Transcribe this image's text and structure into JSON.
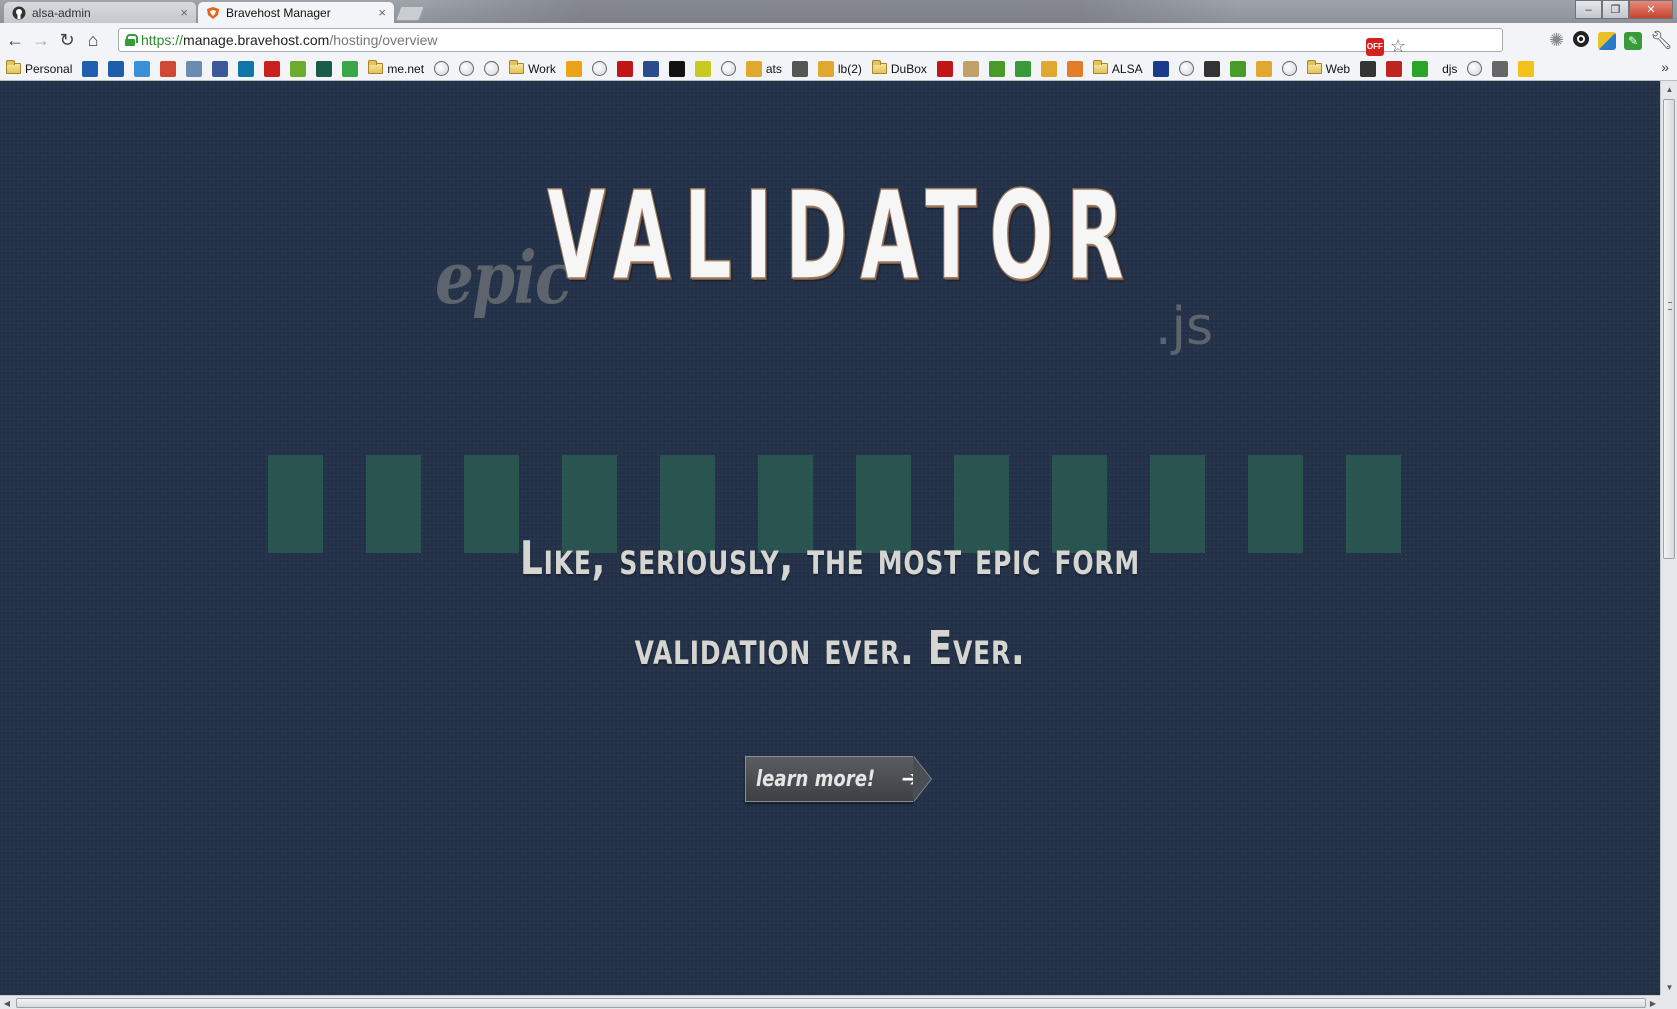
{
  "browser": {
    "tabs": [
      {
        "title": "alsa-admin",
        "icon": "github-icon"
      },
      {
        "title": "Bravehost Manager",
        "icon": "bravehost-shield-icon"
      }
    ],
    "url": {
      "scheme": "https://",
      "host": "manage.bravehost.com",
      "path": "/hosting/overview"
    }
  },
  "bookmarks": [
    {
      "type": "folder",
      "label": "Personal"
    },
    {
      "type": "icon",
      "icon": "diamond-icon",
      "color": "#1f5fb0"
    },
    {
      "type": "icon",
      "icon": "chase-icon",
      "color": "#1a5fa8"
    },
    {
      "type": "icon",
      "icon": "grid-icon",
      "color": "#3a8fd6"
    },
    {
      "type": "icon",
      "icon": "gmail-icon",
      "color": "#d14836"
    },
    {
      "type": "icon",
      "icon": "world-icon",
      "color": "#6a8cb0"
    },
    {
      "type": "icon",
      "icon": "facebook-icon",
      "color": "#3b5998"
    },
    {
      "type": "icon",
      "icon": "linkedin-icon",
      "color": "#0e76a8"
    },
    {
      "type": "icon",
      "icon": "youtube-icon",
      "color": "#cc1f1f"
    },
    {
      "type": "icon",
      "icon": "h-icon",
      "color": "#6dab2c"
    },
    {
      "type": "icon",
      "icon": "slash-icon",
      "color": "#1b5b4a"
    },
    {
      "type": "icon",
      "icon": "sheet-icon",
      "color": "#3aa64a"
    },
    {
      "type": "folder",
      "label": "me.net"
    },
    {
      "type": "globe"
    },
    {
      "type": "globe"
    },
    {
      "type": "globe"
    },
    {
      "type": "folder",
      "label": "Work"
    },
    {
      "type": "icon",
      "icon": "hash-icon",
      "color": "#e8a317"
    },
    {
      "type": "globe"
    },
    {
      "type": "icon",
      "icon": "record-icon",
      "color": "#c01616"
    },
    {
      "type": "icon",
      "icon": "checker-icon",
      "color": "#2b4c8c"
    },
    {
      "type": "icon",
      "icon": "circle-icon",
      "color": "#111111"
    },
    {
      "type": "icon",
      "icon": "leaf-icon",
      "color": "#c9c923"
    },
    {
      "type": "globe"
    },
    {
      "type": "icon",
      "icon": "pma-icon",
      "color": "#e0a82e",
      "label": "ats"
    },
    {
      "type": "icon",
      "icon": "github-icon",
      "color": "#555555"
    },
    {
      "type": "icon",
      "icon": "pma-icon",
      "color": "#e0a82e",
      "label": "lb(2)"
    },
    {
      "type": "folder",
      "label": "DuBox"
    },
    {
      "type": "icon",
      "icon": "record-icon",
      "color": "#c01616"
    },
    {
      "type": "icon",
      "icon": "hand-icon",
      "color": "#c2a06a"
    },
    {
      "type": "icon",
      "icon": "cactus-icon",
      "color": "#4a9a2a"
    },
    {
      "type": "icon",
      "icon": "evernote-icon",
      "color": "#3a9a3a"
    },
    {
      "type": "icon",
      "icon": "pma-icon",
      "color": "#e0a82e"
    },
    {
      "type": "icon",
      "icon": "box-icon",
      "color": "#e27d2a"
    },
    {
      "type": "folder",
      "label": "ALSA"
    },
    {
      "type": "icon",
      "icon": "ibm-icon",
      "color": "#1a3a8a"
    },
    {
      "type": "globe"
    },
    {
      "type": "icon",
      "icon": "github-icon",
      "color": "#333333"
    },
    {
      "type": "icon",
      "icon": "cactus-icon",
      "color": "#4a9a2a"
    },
    {
      "type": "icon",
      "icon": "pma-icon",
      "color": "#e0a82e"
    },
    {
      "type": "globe"
    },
    {
      "type": "folder",
      "label": "Web"
    },
    {
      "type": "icon",
      "icon": "horse-icon",
      "color": "#333333"
    },
    {
      "type": "icon",
      "icon": "bird-icon",
      "color": "#c0241e"
    },
    {
      "type": "icon",
      "icon": "c-icon",
      "color": "#2aa52a"
    },
    {
      "type": "text",
      "label": "djs"
    },
    {
      "type": "globe"
    },
    {
      "type": "icon",
      "icon": "apps-icon",
      "color": "#666666"
    },
    {
      "type": "icon",
      "icon": "sun-icon",
      "color": "#f2c21b"
    }
  ],
  "hero": {
    "logo_prefix": "epic",
    "logo_main": "VALIDATOR",
    "logo_suffix": ".js",
    "tagline_line1": "Like, seriously, the most epic form",
    "tagline_line2": "validation ever. Ever.",
    "cta_label": "learn more!",
    "cta_icon": "arrow-right-icon",
    "colors": {
      "background": "#243249",
      "stripe": "#2a5a50",
      "tagline": "#d5d5d1",
      "logo_main": "#f6f6f6"
    },
    "stripe_count": 12
  }
}
